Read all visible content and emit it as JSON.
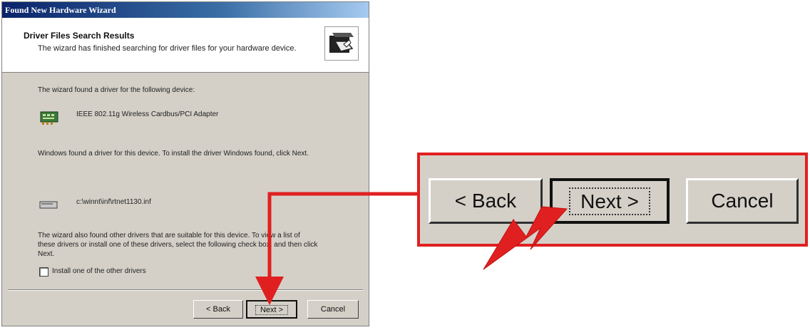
{
  "window": {
    "title": "Found New Hardware Wizard"
  },
  "header": {
    "title": "Driver Files Search Results",
    "subtitle": "The wizard has finished searching for driver files for your hardware device."
  },
  "body": {
    "found_text": "The wizard found a driver for the following device:",
    "device_name": "IEEE 802.11g Wireless Cardbus/PCI Adapter",
    "windows_found_text": "Windows found a driver for this device. To install the driver Windows found, click Next.",
    "driver_path": "c:\\winnt\\inf\\rtnet1130.inf",
    "other_drivers_text_1": "The wizard also found other drivers that are suitable for this device. To view a list of",
    "other_drivers_text_2": "these drivers or install one of these drivers, select the following check box, and then click",
    "other_drivers_text_3": "Next.",
    "checkbox_label": "Install one of the other drivers",
    "checkbox_checked": false
  },
  "buttons": {
    "back": "< Back",
    "next": "Next >",
    "cancel": "Cancel"
  },
  "callout": {
    "back": "< Back",
    "next": "Next >",
    "cancel": "Cancel",
    "frame_color": "#e02020",
    "arrow_color": "#e02020"
  }
}
